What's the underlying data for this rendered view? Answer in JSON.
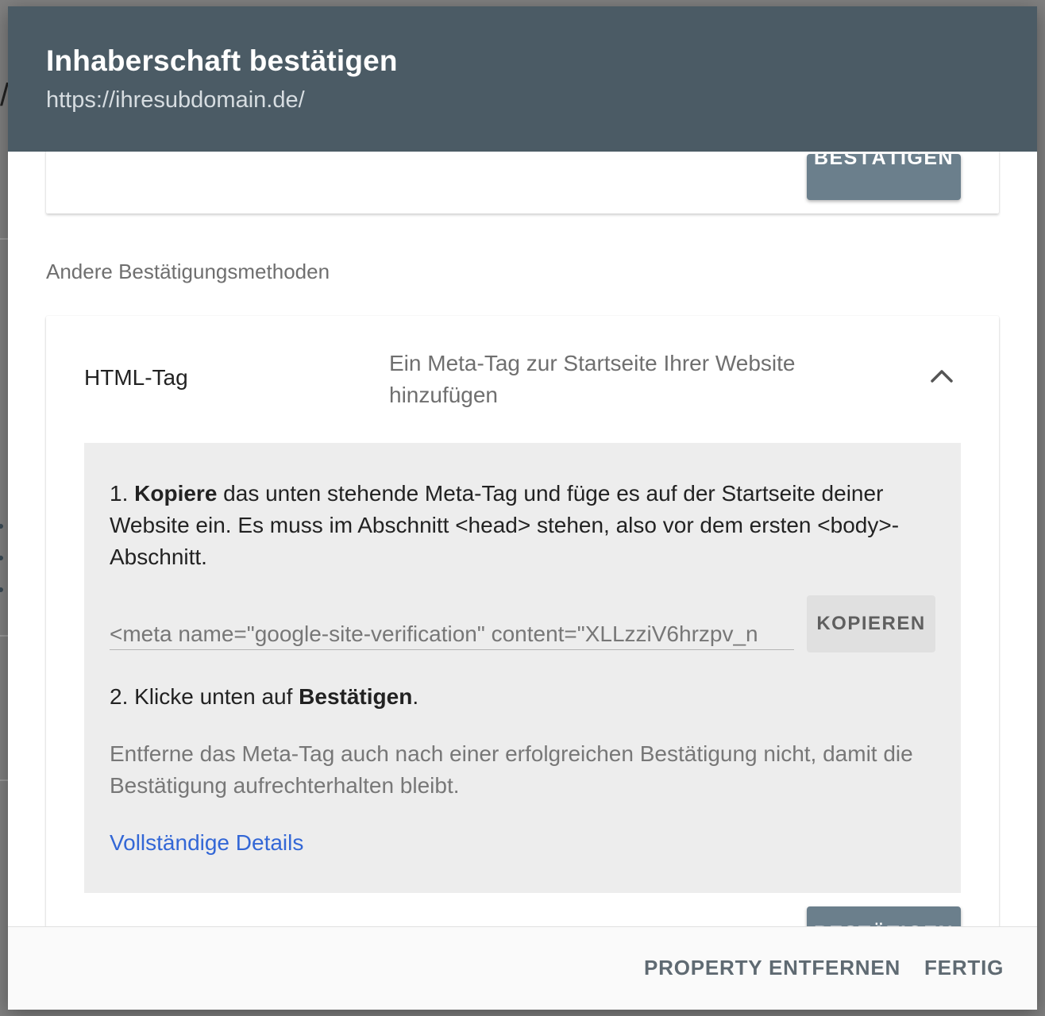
{
  "dialog": {
    "title": "Inhaberschaft bestätigen",
    "subtitle": "https://ihresubdomain.de/"
  },
  "top_card": {
    "confirm_label": "BESTÄTIGEN"
  },
  "other_methods_label": "Andere Bestätigungsmethoden",
  "html_tag_method": {
    "name": "HTML-Tag",
    "description": "Ein Meta-Tag zur Startseite Ihrer Website hinzufügen",
    "expand_icon": "chevron-up-icon",
    "step1": {
      "number": "1. ",
      "bold": "Kopiere",
      "text": " das unten stehende Meta-Tag und füge es auf der Startseite deiner Website ein. Es muss im Abschnitt <head> stehen, also vor dem ersten <body>-Abschnitt."
    },
    "meta_tag_value": "<meta name=\"google-site-verification\" content=\"XLLzziV6hrzpv_n",
    "copy_label": "KOPIEREN",
    "step2": {
      "prefix": "2. Klicke unten auf ",
      "bold": "Bestätigen",
      "suffix": "."
    },
    "note": "Entferne das Meta-Tag auch nach einer erfolgreichen Bestätigung nicht, damit die Bestätigung aufrechterhalten bleibt.",
    "details_link": "Vollständige Details",
    "confirm_label": "BESTÄTIGEN"
  },
  "footer": {
    "remove_label": "PROPERTY ENTFERNEN",
    "done_label": "FERTIG"
  },
  "colors": {
    "header_bg": "#4b5b65",
    "confirm_button": "#6b7f8c",
    "link": "#3367d6",
    "instructions_bg": "#ededed"
  }
}
